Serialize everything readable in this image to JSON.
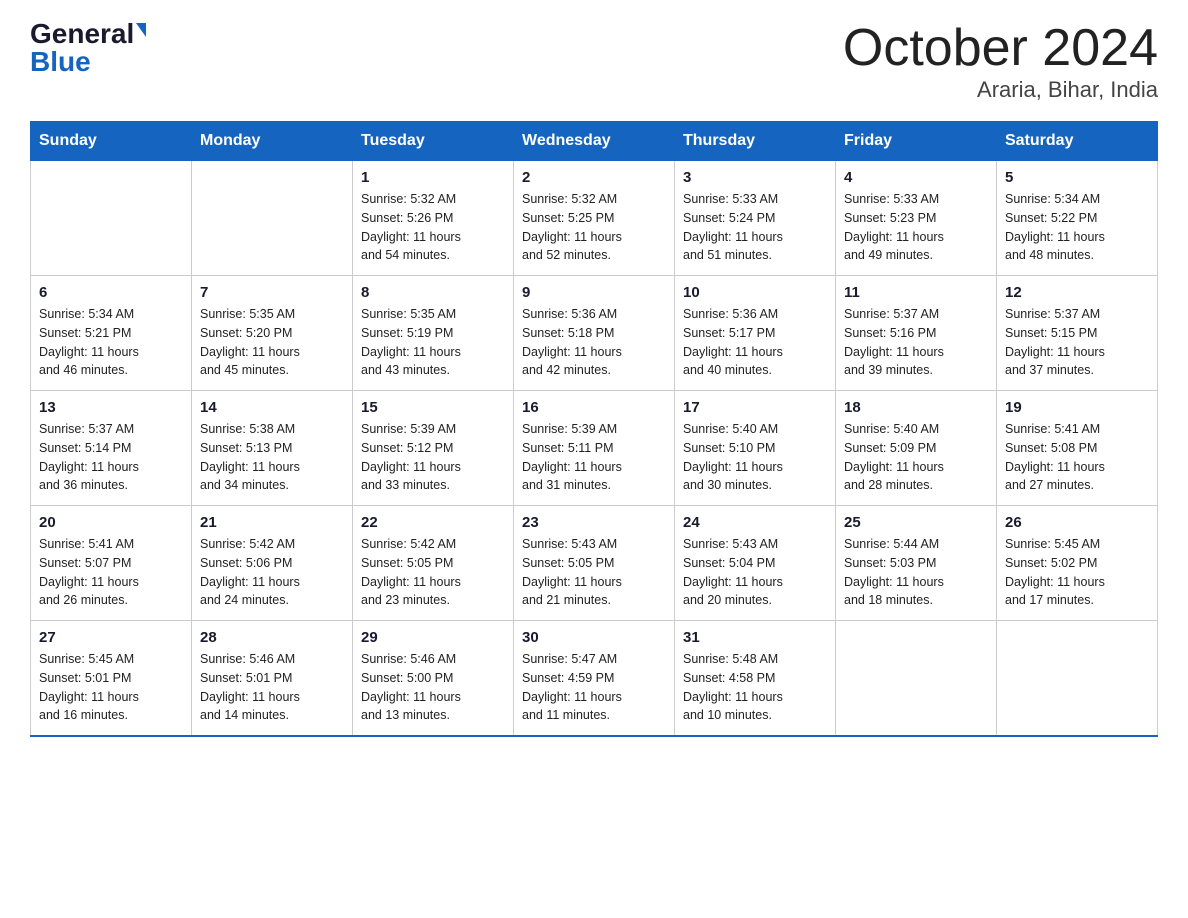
{
  "header": {
    "logo_general": "General",
    "logo_blue": "Blue",
    "month_title": "October 2024",
    "location": "Araria, Bihar, India"
  },
  "days_of_week": [
    "Sunday",
    "Monday",
    "Tuesday",
    "Wednesday",
    "Thursday",
    "Friday",
    "Saturday"
  ],
  "weeks": [
    [
      {
        "day": "",
        "info": ""
      },
      {
        "day": "",
        "info": ""
      },
      {
        "day": "1",
        "info": "Sunrise: 5:32 AM\nSunset: 5:26 PM\nDaylight: 11 hours\nand 54 minutes."
      },
      {
        "day": "2",
        "info": "Sunrise: 5:32 AM\nSunset: 5:25 PM\nDaylight: 11 hours\nand 52 minutes."
      },
      {
        "day": "3",
        "info": "Sunrise: 5:33 AM\nSunset: 5:24 PM\nDaylight: 11 hours\nand 51 minutes."
      },
      {
        "day": "4",
        "info": "Sunrise: 5:33 AM\nSunset: 5:23 PM\nDaylight: 11 hours\nand 49 minutes."
      },
      {
        "day": "5",
        "info": "Sunrise: 5:34 AM\nSunset: 5:22 PM\nDaylight: 11 hours\nand 48 minutes."
      }
    ],
    [
      {
        "day": "6",
        "info": "Sunrise: 5:34 AM\nSunset: 5:21 PM\nDaylight: 11 hours\nand 46 minutes."
      },
      {
        "day": "7",
        "info": "Sunrise: 5:35 AM\nSunset: 5:20 PM\nDaylight: 11 hours\nand 45 minutes."
      },
      {
        "day": "8",
        "info": "Sunrise: 5:35 AM\nSunset: 5:19 PM\nDaylight: 11 hours\nand 43 minutes."
      },
      {
        "day": "9",
        "info": "Sunrise: 5:36 AM\nSunset: 5:18 PM\nDaylight: 11 hours\nand 42 minutes."
      },
      {
        "day": "10",
        "info": "Sunrise: 5:36 AM\nSunset: 5:17 PM\nDaylight: 11 hours\nand 40 minutes."
      },
      {
        "day": "11",
        "info": "Sunrise: 5:37 AM\nSunset: 5:16 PM\nDaylight: 11 hours\nand 39 minutes."
      },
      {
        "day": "12",
        "info": "Sunrise: 5:37 AM\nSunset: 5:15 PM\nDaylight: 11 hours\nand 37 minutes."
      }
    ],
    [
      {
        "day": "13",
        "info": "Sunrise: 5:37 AM\nSunset: 5:14 PM\nDaylight: 11 hours\nand 36 minutes."
      },
      {
        "day": "14",
        "info": "Sunrise: 5:38 AM\nSunset: 5:13 PM\nDaylight: 11 hours\nand 34 minutes."
      },
      {
        "day": "15",
        "info": "Sunrise: 5:39 AM\nSunset: 5:12 PM\nDaylight: 11 hours\nand 33 minutes."
      },
      {
        "day": "16",
        "info": "Sunrise: 5:39 AM\nSunset: 5:11 PM\nDaylight: 11 hours\nand 31 minutes."
      },
      {
        "day": "17",
        "info": "Sunrise: 5:40 AM\nSunset: 5:10 PM\nDaylight: 11 hours\nand 30 minutes."
      },
      {
        "day": "18",
        "info": "Sunrise: 5:40 AM\nSunset: 5:09 PM\nDaylight: 11 hours\nand 28 minutes."
      },
      {
        "day": "19",
        "info": "Sunrise: 5:41 AM\nSunset: 5:08 PM\nDaylight: 11 hours\nand 27 minutes."
      }
    ],
    [
      {
        "day": "20",
        "info": "Sunrise: 5:41 AM\nSunset: 5:07 PM\nDaylight: 11 hours\nand 26 minutes."
      },
      {
        "day": "21",
        "info": "Sunrise: 5:42 AM\nSunset: 5:06 PM\nDaylight: 11 hours\nand 24 minutes."
      },
      {
        "day": "22",
        "info": "Sunrise: 5:42 AM\nSunset: 5:05 PM\nDaylight: 11 hours\nand 23 minutes."
      },
      {
        "day": "23",
        "info": "Sunrise: 5:43 AM\nSunset: 5:05 PM\nDaylight: 11 hours\nand 21 minutes."
      },
      {
        "day": "24",
        "info": "Sunrise: 5:43 AM\nSunset: 5:04 PM\nDaylight: 11 hours\nand 20 minutes."
      },
      {
        "day": "25",
        "info": "Sunrise: 5:44 AM\nSunset: 5:03 PM\nDaylight: 11 hours\nand 18 minutes."
      },
      {
        "day": "26",
        "info": "Sunrise: 5:45 AM\nSunset: 5:02 PM\nDaylight: 11 hours\nand 17 minutes."
      }
    ],
    [
      {
        "day": "27",
        "info": "Sunrise: 5:45 AM\nSunset: 5:01 PM\nDaylight: 11 hours\nand 16 minutes."
      },
      {
        "day": "28",
        "info": "Sunrise: 5:46 AM\nSunset: 5:01 PM\nDaylight: 11 hours\nand 14 minutes."
      },
      {
        "day": "29",
        "info": "Sunrise: 5:46 AM\nSunset: 5:00 PM\nDaylight: 11 hours\nand 13 minutes."
      },
      {
        "day": "30",
        "info": "Sunrise: 5:47 AM\nSunset: 4:59 PM\nDaylight: 11 hours\nand 11 minutes."
      },
      {
        "day": "31",
        "info": "Sunrise: 5:48 AM\nSunset: 4:58 PM\nDaylight: 11 hours\nand 10 minutes."
      },
      {
        "day": "",
        "info": ""
      },
      {
        "day": "",
        "info": ""
      }
    ]
  ]
}
